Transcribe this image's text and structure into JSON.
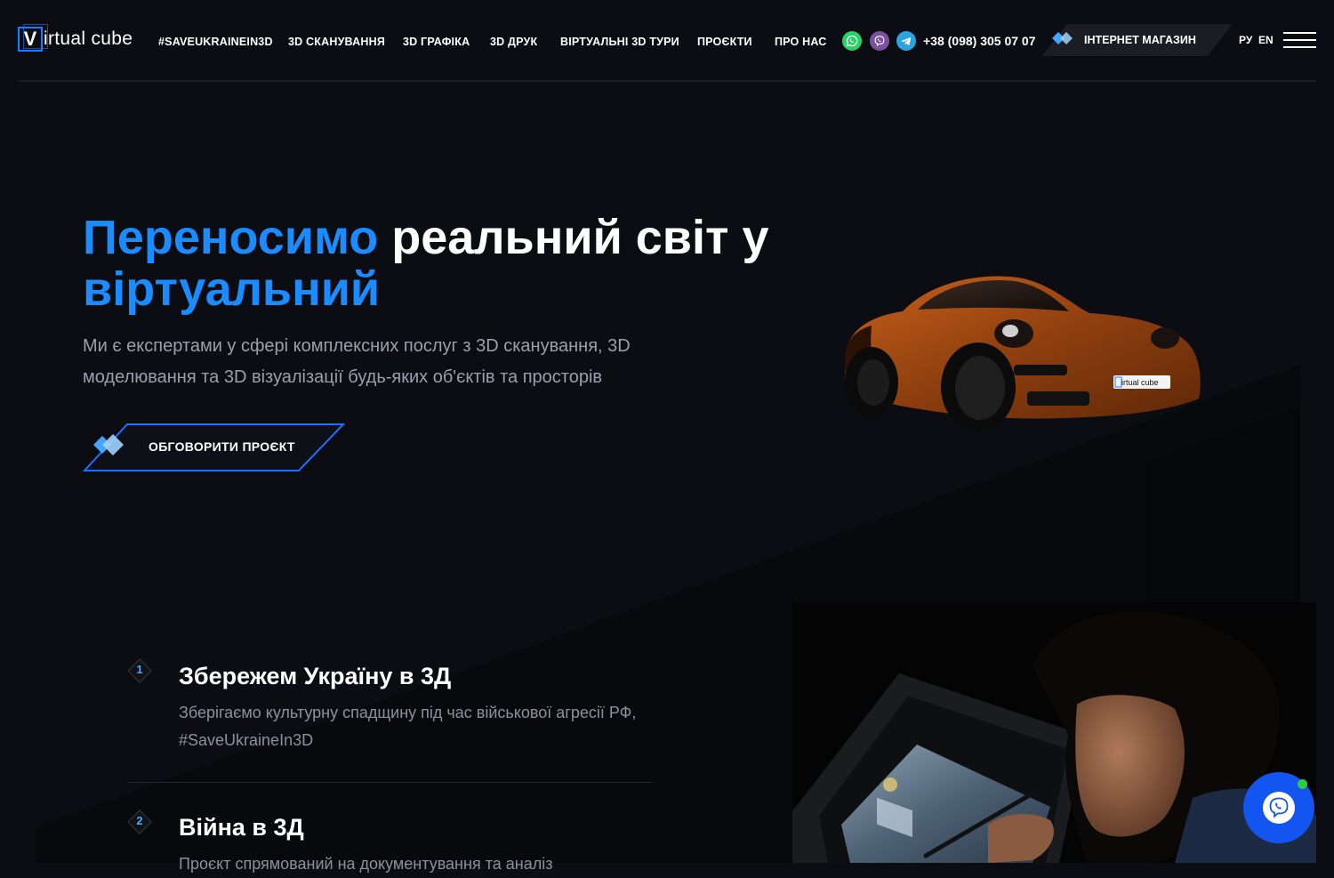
{
  "header": {
    "logo_letter": "V",
    "logo_text": "irtual cube",
    "nav": [
      {
        "label": "#SAVEUKRAINEIN3D"
      },
      {
        "label": "3D СКАНУВАННЯ"
      },
      {
        "label": "3D ГРАФІКА"
      },
      {
        "label": "3D ДРУК"
      },
      {
        "label": "ВІРТУАЛЬНІ 3D ТУРИ"
      },
      {
        "label": "ПРОЄКТИ"
      },
      {
        "label": "ПРО НАС"
      }
    ],
    "messengers": [
      "whatsapp-icon",
      "viber-icon",
      "telegram-icon"
    ],
    "phone": "+38 (098) 305 07 07",
    "shop_label": "ІНТЕРНЕТ МАГАЗИН",
    "lang": [
      "РУ",
      "EN"
    ]
  },
  "hero": {
    "title_highlight": "Переносимо",
    "title_rest": " реальний світ у ",
    "title_highlight2": "віртуальний",
    "subtitle": "Ми є експертами у сфері комплексних послуг з 3D сканування, 3D моделювання та 3D візуалізації будь-яких об'єктів та просторів",
    "cta_label": "ОБГОВОРИТИ ПРОЄКТ",
    "car_plate": "irtual cube"
  },
  "features": [
    {
      "num": "1",
      "title": "Збережем Україну в 3Д",
      "desc": "Зберігаємо культурну спадщину під час військової агресії РФ, #SaveUkraineIn3D"
    },
    {
      "num": "2",
      "title": "Війна в 3Д",
      "desc": "Проєкт спрямований на документування та аналіз"
    }
  ],
  "colors": {
    "accent": "#1a8cff",
    "background": "#0c0d12",
    "chat": "#1355f0"
  }
}
